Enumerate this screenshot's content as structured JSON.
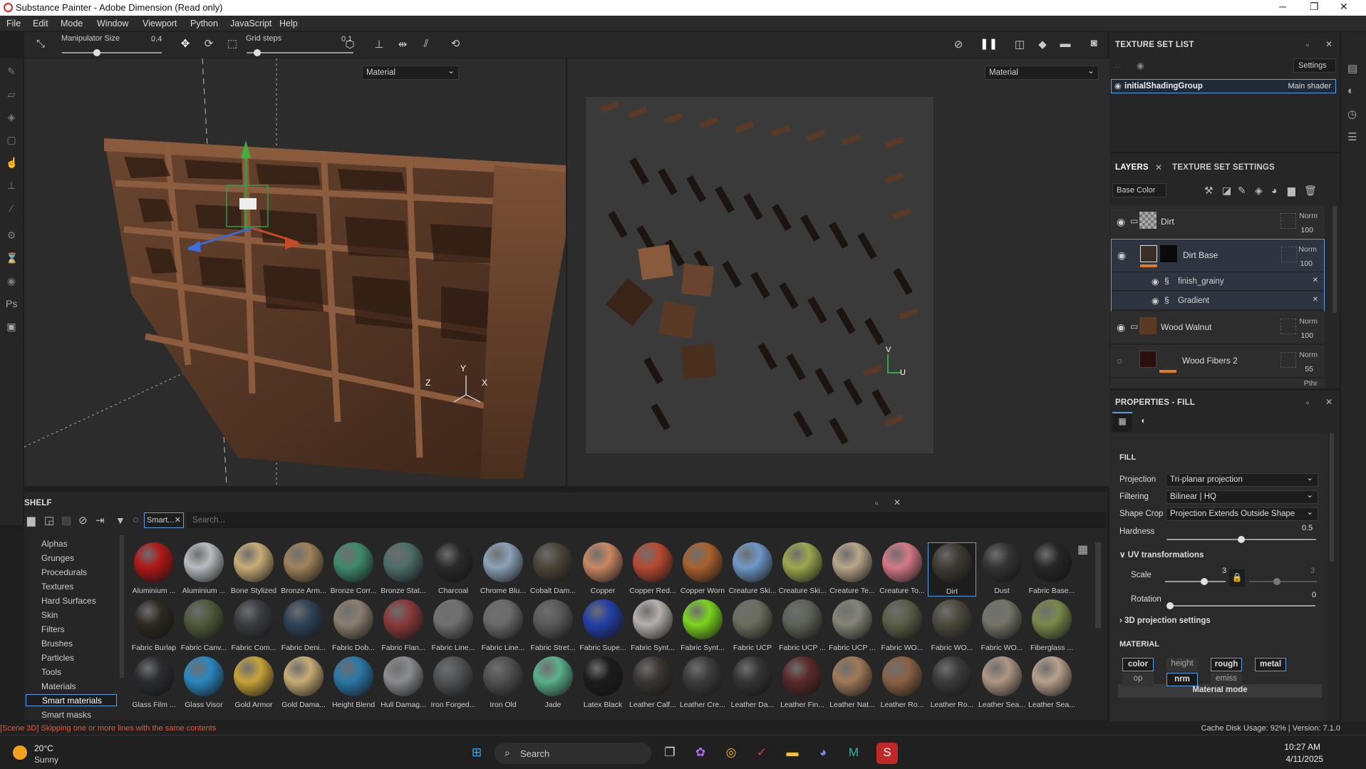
{
  "window": {
    "title": "Substance Painter - Adobe Dimension (Read only)",
    "controls": [
      "─",
      "❐",
      "✕"
    ]
  },
  "menu": [
    "File",
    "Edit",
    "Mode",
    "Window",
    "Viewport",
    "Python",
    "JavaScript",
    "Help"
  ],
  "toolbar": {
    "manip_label": "Manipulator Size",
    "manip_value": "0.4",
    "manip_level": 0.35,
    "grid_label": "Grid steps",
    "grid_value": "0.1",
    "grid_level": 0.1
  },
  "viewports": {
    "left_mode": "Material",
    "right_mode": "Material",
    "axes_3d": [
      "Y",
      "Z",
      "X"
    ],
    "axes_2d": [
      "V",
      "U"
    ]
  },
  "texture_set_list": {
    "title": "TEXTURE SET LIST",
    "settings_label": "Settings",
    "set_name": "initialShadingGroup",
    "shader": "Main shader"
  },
  "layers_panel": {
    "tab_layers": "LAYERS",
    "tab_tss": "TEXTURE SET SETTINGS",
    "channel": "Base Color",
    "items": [
      {
        "name": "Dirt",
        "blend": "Norm",
        "opacity": "100"
      },
      {
        "name": "Dirt Base",
        "blend": "Norm",
        "opacity": "100"
      },
      {
        "name": "finish_grainy"
      },
      {
        "name": "Gradient"
      },
      {
        "name": "Wood Walnut",
        "blend": "Norm",
        "opacity": "100"
      },
      {
        "name": "Wood Fibers 2",
        "blend": "Norm",
        "opacity": "55"
      },
      {
        "name": "",
        "blend": "Pthr",
        "opacity": ""
      }
    ]
  },
  "properties": {
    "title": "PROPERTIES - FILL",
    "section_fill": "FILL",
    "projection_label": "Projection",
    "projection": "Tri-planar projection",
    "filtering_label": "Filtering",
    "filtering": "Bilinear | HQ",
    "shapecrop_label": "Shape Crop",
    "shapecrop": "Projection Extends Outside Shape",
    "hardness_label": "Hardness",
    "hardness": "0.5",
    "uv_label": "UV transformations",
    "scale_label": "Scale",
    "scale": "3",
    "scale2": "3",
    "rotation_label": "Rotation",
    "rotation": "0",
    "proj3d_label": "3D projection settings",
    "material_label": "MATERIAL",
    "channels": [
      {
        "name": "color",
        "on": true
      },
      {
        "name": "height",
        "on": false
      },
      {
        "name": "rough",
        "on": true
      },
      {
        "name": "metal",
        "on": true
      },
      {
        "name": "op",
        "on": false
      },
      {
        "name": "nrm",
        "on": true
      },
      {
        "name": "emiss",
        "on": false
      }
    ],
    "mode_label": "Material mode"
  },
  "shelf": {
    "title": "SHELF",
    "filter_tag": "Smart...",
    "search_placeholder": "Search...",
    "categories": [
      "Alphas",
      "Grunges",
      "Procedurals",
      "Textures",
      "Hard Surfaces",
      "Skin",
      "Filters",
      "Brushes",
      "Particles",
      "Tools",
      "Materials",
      "Smart materials",
      "Smart masks"
    ],
    "selected_category": "Smart materials",
    "materials": [
      {
        "name": "Aluminium ...",
        "color": "#b01818"
      },
      {
        "name": "Aluminium ...",
        "color": "#b8bcc0"
      },
      {
        "name": "Bone Stylized",
        "color": "#c9ad77"
      },
      {
        "name": "Bronze Arm...",
        "color": "#a0825a"
      },
      {
        "name": "Bronze Corr...",
        "color": "#3f8a6e"
      },
      {
        "name": "Bronze Stat...",
        "color": "#4e6e6a"
      },
      {
        "name": "Charcoal",
        "color": "#2a2a2a"
      },
      {
        "name": "Chrome Blu...",
        "color": "#8ba2b8"
      },
      {
        "name": "Cobalt Dam...",
        "color": "#4a4438"
      },
      {
        "name": "Copper",
        "color": "#c98862"
      },
      {
        "name": "Copper Red...",
        "color": "#b84a32"
      },
      {
        "name": "Copper Worn",
        "color": "#a8622e"
      },
      {
        "name": "Creature Ski...",
        "color": "#6f98c8"
      },
      {
        "name": "Creature Ski...",
        "color": "#9ca84e"
      },
      {
        "name": "Creature Te...",
        "color": "#b8a58a"
      },
      {
        "name": "Creature To...",
        "color": "#d47a88"
      },
      {
        "name": "Dirt",
        "color": "#3e3a34"
      },
      {
        "name": "Dust",
        "color": "#333333"
      },
      {
        "name": "Fabric Base...",
        "color": "#262626"
      },
      {
        "name": "Fabric Burlap",
        "color": "#2e2a22"
      },
      {
        "name": "Fabric Canv...",
        "color": "#4f5a3a"
      },
      {
        "name": "Fabric Com...",
        "color": "#3a3c40"
      },
      {
        "name": "Fabric Deni...",
        "color": "#2f4258"
      },
      {
        "name": "Fabric Dob...",
        "color": "#8a7e70"
      },
      {
        "name": "Fabric Flan...",
        "color": "#8a3a3a"
      },
      {
        "name": "Fabric Line...",
        "color": "#707070"
      },
      {
        "name": "Fabric Line...",
        "color": "#6a6a6a"
      },
      {
        "name": "Fabric Stret...",
        "color": "#5a5a5a"
      },
      {
        "name": "Fabric Supe...",
        "color": "#2440a8"
      },
      {
        "name": "Fabric Synt...",
        "color": "#b4b0ac"
      },
      {
        "name": "Fabric Synt...",
        "color": "#7cd420"
      },
      {
        "name": "Fabric UCP",
        "color": "#6a6e5e"
      },
      {
        "name": "Fabric UCP ...",
        "color": "#5e6258"
      },
      {
        "name": "Fabric UCP ...",
        "color": "#848478"
      },
      {
        "name": "Fabric WO...",
        "color": "#5a5e46"
      },
      {
        "name": "Fabric WO...",
        "color": "#4c4a3e"
      },
      {
        "name": "Fabric WO...",
        "color": "#747468"
      },
      {
        "name": "Fiberglass ...",
        "color": "#7a8a4a"
      },
      {
        "name": "Glass Film ...",
        "color": "#2a2c30"
      },
      {
        "name": "Glass Visor",
        "color": "#2a88c0"
      },
      {
        "name": "Gold Armor",
        "color": "#c8a43a"
      },
      {
        "name": "Gold Dama...",
        "color": "#c8ac74"
      },
      {
        "name": "Height Blend",
        "color": "#2a78a8"
      },
      {
        "name": "Hull Damag...",
        "color": "#8a8c90"
      },
      {
        "name": "Iron Forged...",
        "color": "#505254"
      },
      {
        "name": "Iron Old",
        "color": "#505050"
      },
      {
        "name": "Jade",
        "color": "#5cb08c"
      },
      {
        "name": "Latex Black",
        "color": "#1c1c1c"
      },
      {
        "name": "Leather Calf...",
        "color": "#3a3632"
      },
      {
        "name": "Leather Cre...",
        "color": "#3c3c3c"
      },
      {
        "name": "Leather Da...",
        "color": "#343434"
      },
      {
        "name": "Leather Fin...",
        "color": "#5a2a2a"
      },
      {
        "name": "Leather Nat...",
        "color": "#a07a58"
      },
      {
        "name": "Leather Ro...",
        "color": "#8a6244"
      },
      {
        "name": "Leather Ro...",
        "color": "#3a3a3a"
      },
      {
        "name": "Leather Sea...",
        "color": "#b09684"
      },
      {
        "name": "Leather Sea...",
        "color": "#b8a08c"
      }
    ],
    "selected_material": "Dirt"
  },
  "status": {
    "message": "[Scene 3D] Skipping one or more lines with the same contents",
    "cache": "Cache Disk Usage:   92%  |  Version: 7.1.0"
  },
  "taskbar": {
    "temp": "20°C",
    "weather": "Sunny",
    "search": "Search",
    "time": "10:27 AM",
    "date": "4/11/2025"
  }
}
